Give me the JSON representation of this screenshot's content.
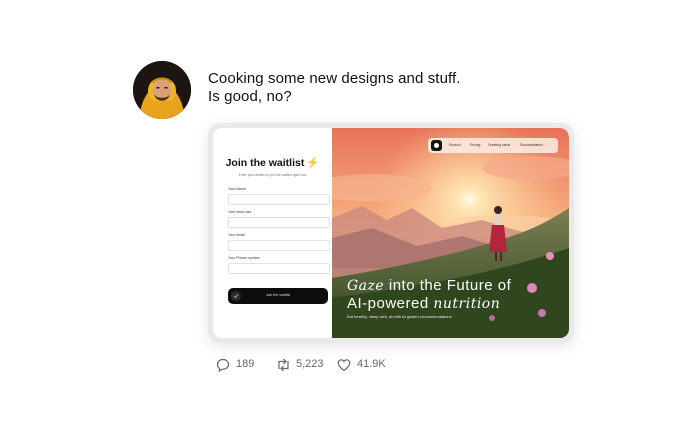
{
  "tweet": {
    "line1": "Cooking some new designs and stuff.",
    "line2": "Is good, no?"
  },
  "avatar": {
    "icon": "avatar-icon"
  },
  "waitlist": {
    "title": "Join the waitlist",
    "title_emoji": "⚡",
    "subtitle": "Enter your details to join the waitlist right now",
    "fields": [
      {
        "label": "Your Name",
        "value": ""
      },
      {
        "label": "Your shoe size",
        "value": ""
      },
      {
        "label": "Your email",
        "value": ""
      },
      {
        "label": "Your Phone number",
        "value": ""
      }
    ],
    "button_label": "Join the waitlist"
  },
  "hero": {
    "nav": [
      "Product",
      "Pricing",
      "Greeting cards",
      "Documentation"
    ],
    "headline_word1": "Gaze",
    "headline_rest1": " into the Future of",
    "headline_line2": "AI-powered ",
    "headline_word2": "nutrition",
    "subtext": "Eat healthy, sleep well, all with AI guided recommendations."
  },
  "actions": {
    "replies": "189",
    "retweets": "5,223",
    "likes": "41.9K"
  },
  "colors": {
    "accent": "#f4b400",
    "sky_top": "#f08a5d",
    "sky_mid": "#f7b27a",
    "grass": "#4a6b2a",
    "button": "#0d0d0d"
  }
}
